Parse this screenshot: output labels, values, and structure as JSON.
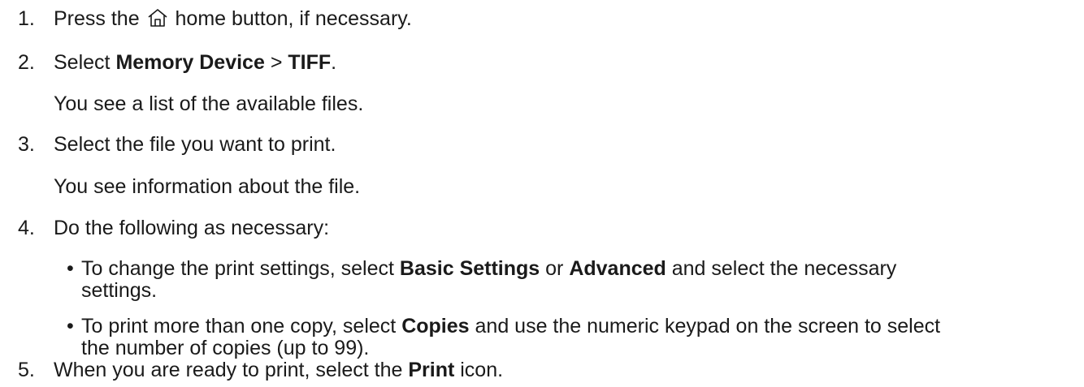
{
  "steps": [
    {
      "number": "1.",
      "pre": "Press the ",
      "icon": "home-icon",
      "post": " home button, if necessary."
    },
    {
      "number": "2.",
      "pre": "Select ",
      "bold1": "Memory Device",
      "mid": " > ",
      "bold2": "TIFF",
      "post": ".",
      "note": "You see a list of the available files."
    },
    {
      "number": "3.",
      "text": "Select the file you want to print.",
      "note": "You see information about the file."
    },
    {
      "number": "4.",
      "text": "Do the following as necessary:",
      "bullets": [
        {
          "symbol": "•",
          "pre": "To change the print settings, select ",
          "bold1": "Basic Settings",
          "mid": " or ",
          "bold2": "Advanced",
          "post1": " and select the necessary",
          "post2": "settings."
        },
        {
          "symbol": "•",
          "pre": "To print more than one copy, select ",
          "bold1": "Copies",
          "post1": " and use the numeric keypad on the screen to select",
          "post2": "the number of copies (up to 99)."
        }
      ]
    },
    {
      "number": "5.",
      "pre": "When you are ready to print, select the ",
      "bold1": "Print",
      "post": " icon."
    }
  ]
}
